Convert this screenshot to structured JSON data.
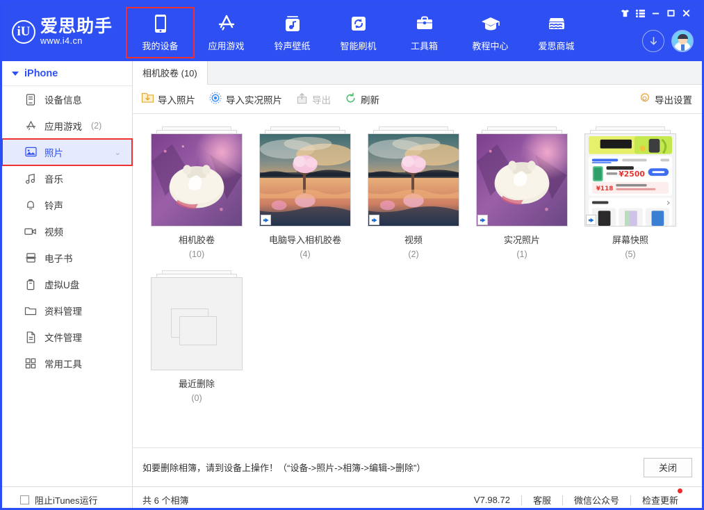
{
  "brand": {
    "logo_mark": "iU",
    "name": "爱思助手",
    "url": "www.i4.cn"
  },
  "window_controls": [
    {
      "name": "skin-icon",
      "label": "皮肤"
    },
    {
      "name": "menu-icon",
      "label": "菜单"
    },
    {
      "name": "minimize-icon",
      "label": "最小化"
    },
    {
      "name": "maximize-icon",
      "label": "最大化"
    },
    {
      "name": "close-icon",
      "label": "关闭"
    }
  ],
  "nav": {
    "items": [
      {
        "label": "我的设备",
        "icon": "phone-icon",
        "active": true
      },
      {
        "label": "应用游戏",
        "icon": "appstore-icon",
        "active": false
      },
      {
        "label": "铃声壁纸",
        "icon": "music-note-icon",
        "active": false
      },
      {
        "label": "智能刷机",
        "icon": "refresh-icon",
        "active": false
      },
      {
        "label": "工具箱",
        "icon": "toolbox-icon",
        "active": false
      },
      {
        "label": "教程中心",
        "icon": "graduation-cap-icon",
        "active": false
      },
      {
        "label": "爱思商城",
        "icon": "store-icon",
        "active": false
      }
    ],
    "download_icon": "download-arrow-icon",
    "avatar_icon": "user-avatar-icon"
  },
  "sidebar": {
    "device": {
      "label": "iPhone",
      "expanded": true
    },
    "items": [
      {
        "label": "设备信息",
        "icon": "device-info-icon",
        "count": "",
        "selected": false,
        "chevron": false
      },
      {
        "label": "应用游戏",
        "icon": "appstore-icon",
        "count": "(2)",
        "selected": false,
        "chevron": false
      },
      {
        "label": "照片",
        "icon": "photo-icon",
        "count": "",
        "selected": true,
        "chevron": true
      },
      {
        "label": "音乐",
        "icon": "music-icon",
        "count": "",
        "selected": false,
        "chevron": false
      },
      {
        "label": "铃声",
        "icon": "bell-icon",
        "count": "",
        "selected": false,
        "chevron": false
      },
      {
        "label": "视频",
        "icon": "video-camera-icon",
        "count": "",
        "selected": false,
        "chevron": false
      },
      {
        "label": "电子书",
        "icon": "ebook-icon",
        "count": "",
        "selected": false,
        "chevron": false
      },
      {
        "label": "虚拟U盘",
        "icon": "usb-drive-icon",
        "count": "",
        "selected": false,
        "chevron": false
      },
      {
        "label": "资料管理",
        "icon": "folder-icon",
        "count": "",
        "selected": false,
        "chevron": false
      },
      {
        "label": "文件管理",
        "icon": "file-icon",
        "count": "",
        "selected": false,
        "chevron": false
      },
      {
        "label": "常用工具",
        "icon": "grid-tools-icon",
        "count": "",
        "selected": false,
        "chevron": false
      }
    ]
  },
  "main": {
    "tabs": [
      {
        "label": "相机胶卷 (10)",
        "active": true
      }
    ],
    "toolbar": [
      {
        "label": "导入照片",
        "icon": "import-photo-icon",
        "disabled": false
      },
      {
        "label": "导入实况照片",
        "icon": "live-photo-icon",
        "disabled": false
      },
      {
        "label": "导出",
        "icon": "export-icon",
        "disabled": true
      },
      {
        "label": "刷新",
        "icon": "refresh-circle-icon",
        "disabled": false
      }
    ],
    "export_settings": {
      "label": "导出设置",
      "icon": "gear-icon"
    },
    "albums": [
      {
        "name": "相机胶卷",
        "count": "(10)",
        "thumb": "photo-airpods-purple",
        "live_badge": false
      },
      {
        "name": "电脑导入相机胶卷",
        "count": "(4)",
        "thumb": "photo-tree-sunset",
        "live_badge": true
      },
      {
        "name": "视频",
        "count": "(2)",
        "thumb": "photo-tree-sunset",
        "live_badge": true
      },
      {
        "name": "实况照片",
        "count": "(1)",
        "thumb": "photo-airpods-purple",
        "live_badge": true
      },
      {
        "name": "屏幕快照",
        "count": "(5)",
        "thumb": "screenshot-recycle-app",
        "live_badge": true
      },
      {
        "name": "最近删除",
        "count": "(0)",
        "thumb": "empty-placeholder",
        "live_badge": false
      }
    ],
    "notice": {
      "text": "如要删除相簿，请到设备上操作！（“设备->照片->相簿->编辑->删除”）",
      "close_label": "关闭"
    }
  },
  "statusbar": {
    "itunes_checkbox": {
      "label": "阻止iTunes运行",
      "checked": false
    },
    "summary": "共 6 个相簿",
    "version": "V7.98.72",
    "links": [
      {
        "label": "客服",
        "dot": false
      },
      {
        "label": "微信公众号",
        "dot": false
      },
      {
        "label": "检查更新",
        "dot": true
      }
    ]
  },
  "screenshot_thumb": {
    "banner_title": "回收加价",
    "model": "iPhone 12 mini",
    "price": "¥2500",
    "price_prefix": "最高可省",
    "bonus": "¥118",
    "bonus_note": "5月回收加价①",
    "bonus_sub": "距离失效倒数 2天 09:41:55",
    "tag_button": "精准估价",
    "tabs": "全部 iPhone 12 mini | 热门 iPhone 14 Pro ...",
    "other": "其它 >",
    "section": "热门机型"
  },
  "colors": {
    "brand_blue": "#2e50f2",
    "highlight_red": "#f1312f",
    "selected_bg": "#e6eaff",
    "accent_orange": "#e8a33d",
    "accent_green": "#4fbf72",
    "notify_red": "#ef2b2b"
  }
}
